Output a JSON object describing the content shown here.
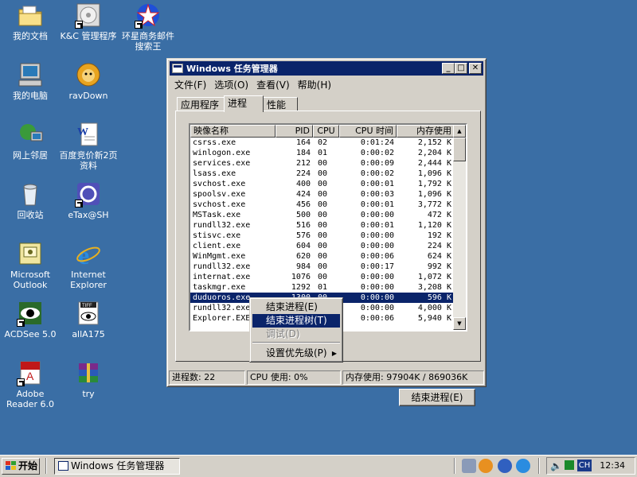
{
  "desktop": {
    "icons": [
      {
        "label": "我的文档"
      },
      {
        "label": "K&C 管理程序"
      },
      {
        "label": "环星商务邮件搜索王"
      },
      {
        "label": "我的电脑"
      },
      {
        "label": "ravDown"
      },
      {
        "label": "网上邻居"
      },
      {
        "label": "百度竞价新2页资料"
      },
      {
        "label": "回收站"
      },
      {
        "label": "eTax@SH"
      },
      {
        "label": "Microsoft Outlook"
      },
      {
        "label": "Internet Explorer"
      },
      {
        "label": "ACDSee 5.0"
      },
      {
        "label": "allA175"
      },
      {
        "label": "Adobe Reader 6.0"
      },
      {
        "label": "try"
      }
    ]
  },
  "window": {
    "title": "Windows 任务管理器",
    "menu": [
      "文件(F)",
      "选项(O)",
      "查看(V)",
      "帮助(H)"
    ],
    "tabs": [
      "应用程序",
      "进程",
      "性能"
    ],
    "active_tab": "进程",
    "columns": [
      "映像名称",
      "PID",
      "CPU",
      "CPU 时间",
      "内存使用"
    ],
    "processes": [
      [
        "csrss.exe",
        "164",
        "02",
        "0:01:24",
        "2,152 K"
      ],
      [
        "winlogon.exe",
        "184",
        "01",
        "0:00:02",
        "2,204 K"
      ],
      [
        "services.exe",
        "212",
        "00",
        "0:00:09",
        "2,444 K"
      ],
      [
        "lsass.exe",
        "224",
        "00",
        "0:00:02",
        "1,096 K"
      ],
      [
        "svchost.exe",
        "400",
        "00",
        "0:00:01",
        "1,792 K"
      ],
      [
        "spoolsv.exe",
        "424",
        "00",
        "0:00:03",
        "1,096 K"
      ],
      [
        "svchost.exe",
        "456",
        "00",
        "0:00:01",
        "3,772 K"
      ],
      [
        "MSTask.exe",
        "500",
        "00",
        "0:00:00",
        "472 K"
      ],
      [
        "rundll32.exe",
        "516",
        "00",
        "0:00:01",
        "1,120 K"
      ],
      [
        "stisvc.exe",
        "576",
        "00",
        "0:00:00",
        "192 K"
      ],
      [
        "client.exe",
        "604",
        "00",
        "0:00:00",
        "224 K"
      ],
      [
        "WinMgmt.exe",
        "620",
        "00",
        "0:00:06",
        "624 K"
      ],
      [
        "rundll32.exe",
        "984",
        "00",
        "0:00:17",
        "992 K"
      ],
      [
        "internat.exe",
        "1076",
        "00",
        "0:00:00",
        "1,072 K"
      ],
      [
        "taskmgr.exe",
        "1292",
        "01",
        "0:00:00",
        "3,208 K"
      ],
      [
        "duduoros.exe",
        "1300",
        "00",
        "0:00:00",
        "596 K"
      ],
      [
        "rundll32.exe",
        "",
        "",
        "0:00:00",
        "4,000 K"
      ],
      [
        "Explorer.EXE",
        "",
        "",
        "0:00:06",
        "5,940 K"
      ]
    ],
    "selected_index": 15,
    "end_process_button": "结束进程(E)",
    "status": {
      "processes": "进程数: 22",
      "cpu": "CPU 使用: 0%",
      "memory": "内存使用: 97904K / 869036K"
    }
  },
  "context_menu": {
    "items": [
      {
        "label": "结束进程(E)",
        "state": "normal"
      },
      {
        "label": "结束进程树(T)",
        "state": "highlighted"
      },
      {
        "label": "调试(D)",
        "state": "disabled"
      },
      {
        "label": "设置优先级(P)",
        "state": "submenu"
      }
    ]
  },
  "taskbar": {
    "start_label": "开始",
    "task_button": "Windows 任务管理器",
    "tray_lang": "CH",
    "clock": "12:34"
  },
  "colors": {
    "desktop": "#3a6ea5",
    "titlebar": "#0a246a",
    "face": "#d4d0c8",
    "selection": "#0a246a"
  }
}
